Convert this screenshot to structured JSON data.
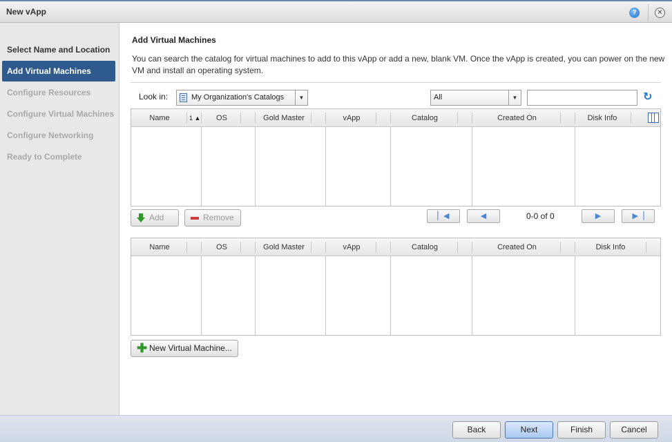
{
  "window": {
    "title": "New vApp",
    "help_icon": "help-icon",
    "close_icon": "close-icon"
  },
  "sidebar": {
    "steps": [
      {
        "label": "Select Name and Location",
        "state": "done"
      },
      {
        "label": "Add Virtual Machines",
        "state": "active"
      },
      {
        "label": "Configure Resources",
        "state": "pending"
      },
      {
        "label": "Configure Virtual Machines",
        "state": "pending"
      },
      {
        "label": "Configure Networking",
        "state": "pending"
      },
      {
        "label": "Ready to Complete",
        "state": "pending"
      }
    ]
  },
  "main": {
    "heading": "Add Virtual Machines",
    "description": "You can search the catalog for virtual machines to add to this vApp or add a new, blank VM. Once the vApp is created, you can power on the new VM and install an operating system.",
    "look_in_label": "Look in:",
    "look_in_value": "My Organization's Catalogs",
    "filter_value": "All",
    "search_value": ""
  },
  "catalog_grid": {
    "columns": [
      "Name",
      "OS",
      "Gold Master",
      "vApp",
      "Catalog",
      "Created On",
      "Disk Info"
    ],
    "sort_indicator": "1 ▲",
    "rows": []
  },
  "actions": {
    "add_label": "Add",
    "remove_label": "Remove",
    "new_vm_label": "New Virtual Machine..."
  },
  "pager": {
    "count_text": "0-0 of 0"
  },
  "selected_grid": {
    "columns": [
      "Name",
      "OS",
      "Gold Master",
      "vApp",
      "Catalog",
      "Created On",
      "Disk Info"
    ],
    "rows": []
  },
  "footer": {
    "back_label": "Back",
    "next_label": "Next",
    "finish_label": "Finish",
    "cancel_label": "Cancel"
  }
}
